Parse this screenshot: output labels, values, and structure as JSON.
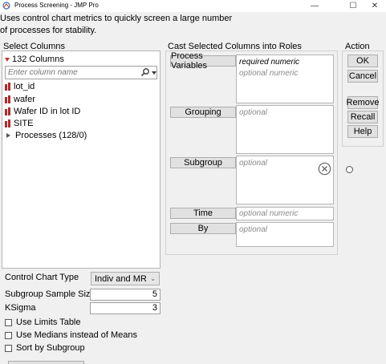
{
  "window": {
    "title": "Process Screening - JMP Pro",
    "minimize": "—",
    "maximize": "☐",
    "close": "✕"
  },
  "description": "Uses control chart metrics to quickly screen a large number of processes for stability.",
  "select_columns": {
    "heading": "Select Columns",
    "count": "132 Columns",
    "search_placeholder": "Enter column name",
    "columns": [
      "lot_id",
      "wafer",
      "Wafer ID in lot ID",
      "SITE"
    ],
    "group": "Processes (128/0)"
  },
  "cast": {
    "heading": "Cast Selected Columns into Roles",
    "roles": [
      {
        "button": "Process Variables",
        "hint1": "required numeric",
        "hint2": "optional numeric"
      },
      {
        "button": "Grouping",
        "hint1": "optional"
      },
      {
        "button": "Subgroup",
        "hint1": "optional"
      },
      {
        "button": "Time",
        "hint1": "optional numeric"
      },
      {
        "button": "By",
        "hint1": "optional"
      }
    ]
  },
  "action": {
    "heading": "Action",
    "buttons": [
      "OK",
      "Cancel",
      "Remove",
      "Recall",
      "Help"
    ]
  },
  "options": {
    "chart_type_label": "Control Chart Type",
    "chart_type_value": "Indiv and MR",
    "sample_size_label": "Subgroup Sample Size",
    "sample_size_value": "5",
    "ksigma_label": "KSigma",
    "ksigma_value": "3",
    "checkboxes": [
      "Use Limits Table",
      "Use Medians instead of Means",
      "Sort by Subgroup"
    ]
  },
  "colors": {
    "continuous_icon": "#b22a2a",
    "background": "#f0f0f0"
  }
}
